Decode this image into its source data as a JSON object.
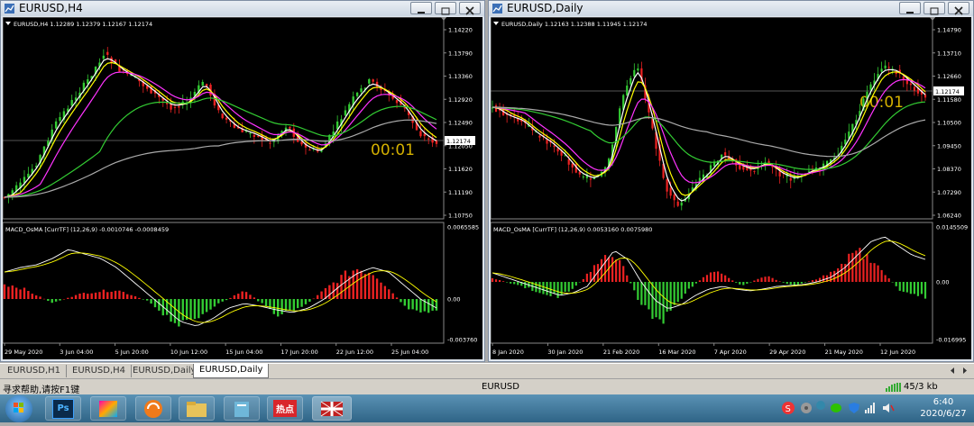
{
  "left_window": {
    "title": "EURUSD,H4",
    "header": "EURUSD,H4  1.12289 1.12379 1.12167 1.12174",
    "price_ticks": [
      "1.14220",
      "1.13790",
      "1.13360",
      "1.12920",
      "1.12490",
      "1.12050",
      "1.11620",
      "1.11190",
      "1.10750"
    ],
    "current_price": "1.12174",
    "timer": "00:01",
    "indicator_header": "MACD_OsMA [CurrTF] (12,26,9) -0.0010746 -0.0008459",
    "indicator_ticks": [
      "0.0065585",
      "0.00",
      "-0.003760"
    ],
    "time_ticks": [
      "29 May 2020",
      "3 Jun 04:00",
      "5 Jun 20:00",
      "10 Jun 12:00",
      "15 Jun 04:00",
      "17 Jun 20:00",
      "22 Jun 12:00",
      "25 Jun 04:00"
    ]
  },
  "right_window": {
    "title": "EURUSD,Daily",
    "header": "EURUSD,Daily  1.12163 1.12388 1.11945 1.12174",
    "price_ticks": [
      "1.14790",
      "1.13710",
      "1.12660",
      "1.11580",
      "1.10500",
      "1.09450",
      "1.08370",
      "1.07290",
      "1.06240"
    ],
    "current_price": "1.12174",
    "timer": "00:01",
    "indicator_header": "MACD_OsMA [CurrTF] (12,26,9) 0.0053160 0.0075980",
    "indicator_ticks": [
      "0.0145509",
      "0.00",
      "-0.016995"
    ],
    "time_ticks": [
      "8 Jan 2020",
      "30 Jan 2020",
      "21 Feb 2020",
      "16 Mar 2020",
      "7 Apr 2020",
      "29 Apr 2020",
      "21 May 2020",
      "12 Jun 2020"
    ]
  },
  "tabs": [
    "EURUSD,H1",
    "EURUSD,H4",
    "EURUSD,Daily",
    "EURUSD,Daily"
  ],
  "active_tab_index": 3,
  "status": {
    "help": "寻求帮助,请按F1键",
    "symbol": "EURUSD",
    "traffic": "45/3 kb"
  },
  "taskbar": {
    "time": "6:40",
    "date": "2020/6/27",
    "apps": [
      "photoshop",
      "colors",
      "orange-app",
      "folder",
      "notebook",
      "hotspot",
      "flag-app"
    ],
    "hotspot_label": "热点",
    "ps_label": "Ps"
  },
  "colors": {
    "bull": "#33cc33",
    "bear": "#ee2222",
    "timer": "#d4b000",
    "ma_white": "#ffffff",
    "ma_yellow": "#ffff00",
    "ma_magenta": "#ff33ff",
    "ma_green": "#33cc33",
    "ma_gray": "#aaaaaa"
  }
}
